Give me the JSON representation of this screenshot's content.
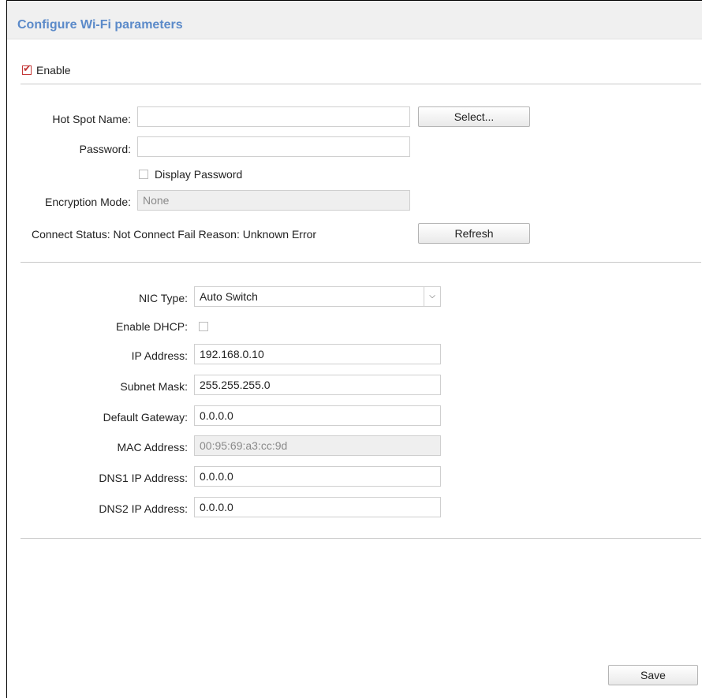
{
  "header": {
    "title": "Configure Wi-Fi parameters"
  },
  "enable": {
    "label": "Enable",
    "checked": true
  },
  "wifi": {
    "hotspot_label": "Hot Spot Name:",
    "hotspot_value": "",
    "select_button": "Select...",
    "password_label": "Password:",
    "password_value": "",
    "display_password_label": "Display Password",
    "encryption_label": "Encryption Mode:",
    "encryption_value": "None",
    "connect_status_label": "Connect Status:",
    "connect_status_value": "Not Connect",
    "fail_reason_label": "Fail Reason:",
    "fail_reason_value": "Unknown Error",
    "refresh_button": "Refresh"
  },
  "network": {
    "nic_type_label": "NIC Type:",
    "nic_type_value": "Auto Switch",
    "dhcp_label": "Enable DHCP:",
    "ip_label": "IP Address:",
    "ip_value": "192.168.0.10",
    "subnet_label": "Subnet Mask:",
    "subnet_value": "255.255.255.0",
    "gateway_label": "Default Gateway:",
    "gateway_value": "0.0.0.0",
    "mac_label": "MAC Address:",
    "mac_value": "00:95:69:a3:cc:9d",
    "dns1_label": "DNS1 IP Address:",
    "dns1_value": "0.0.0.0",
    "dns2_label": "DNS2 IP Address:",
    "dns2_value": "0.0.0.0"
  },
  "footer": {
    "save_button": "Save"
  }
}
